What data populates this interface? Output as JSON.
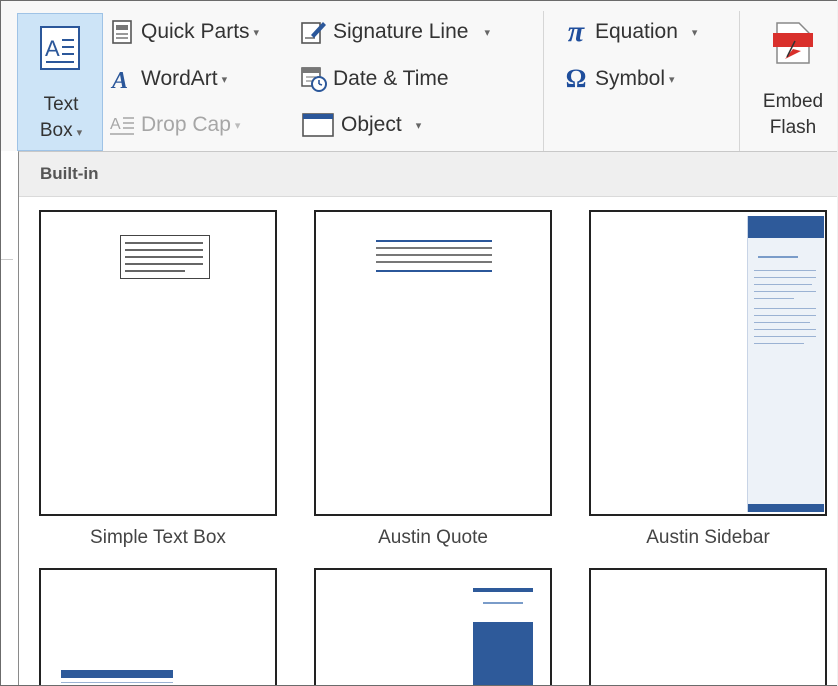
{
  "ribbon": {
    "text_box": {
      "line1": "Text",
      "line2": "Box",
      "arrow": "▾",
      "icon": "text-box-icon"
    },
    "quick_parts": {
      "label": "Quick Parts",
      "arrow": "▾",
      "icon": "quick-parts-icon"
    },
    "wordart": {
      "label": "WordArt",
      "arrow": "▾",
      "icon": "wordart-icon"
    },
    "drop_cap": {
      "label": "Drop Cap",
      "arrow": "▾",
      "icon": "drop-cap-icon",
      "disabled": true
    },
    "signature_line": {
      "label": "Signature Line",
      "arrow": "▾",
      "icon": "signature-line-icon"
    },
    "date_time": {
      "label": "Date & Time",
      "icon": "date-time-icon"
    },
    "object": {
      "label": "Object",
      "arrow": "▾",
      "icon": "object-icon"
    },
    "equation": {
      "label": "Equation",
      "arrow": "▾",
      "icon": "pi-icon",
      "glyph": "π"
    },
    "symbol": {
      "label": "Symbol",
      "arrow": "▾",
      "icon": "omega-icon",
      "glyph": "Ω"
    },
    "embed_flash": {
      "line1": "Embed",
      "line2": "Flash",
      "icon": "embed-flash-icon"
    }
  },
  "gallery": {
    "section": "Built-in",
    "items": [
      {
        "label": "Simple Text Box"
      },
      {
        "label": "Austin Quote"
      },
      {
        "label": "Austin Sidebar"
      }
    ]
  },
  "colors": {
    "accent": "#2b579a",
    "selected": "#cde4f7",
    "sidebar_blue": "#2e5a9a",
    "pi_blue": "#1f4e9c"
  }
}
